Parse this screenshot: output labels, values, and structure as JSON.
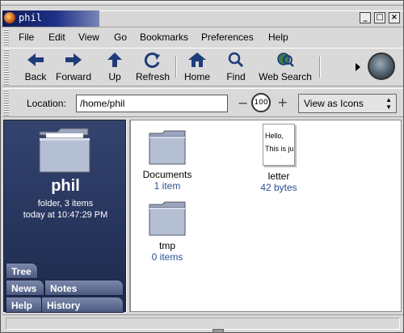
{
  "window": {
    "title": "phil"
  },
  "menu": [
    "File",
    "Edit",
    "View",
    "Go",
    "Bookmarks",
    "Preferences",
    "Help"
  ],
  "toolbar": {
    "back": "Back",
    "forward": "Forward",
    "up": "Up",
    "refresh": "Refresh",
    "home": "Home",
    "find": "Find",
    "web_search": "Web Search"
  },
  "location": {
    "label": "Location:",
    "value": "/home/phil",
    "zoom": "100",
    "view_mode": "View as Icons"
  },
  "sidebar": {
    "folder_name": "phil",
    "info_line1": "folder, 3 items",
    "info_line2": "today at 10:47:29 PM",
    "tabs": {
      "tree": "Tree",
      "news": "News",
      "notes": "Notes",
      "help": "Help",
      "history": "History"
    }
  },
  "files": [
    {
      "name": "Documents",
      "detail": "1 item",
      "icon": "folder-icon"
    },
    {
      "name": "letter",
      "detail": "42 bytes",
      "icon": "text-document-icon",
      "preview_line1": "Hello,",
      "preview_line2": "This is ju"
    },
    {
      "name": "tmp",
      "detail": "0 items",
      "icon": "folder-icon"
    }
  ],
  "colors": {
    "sidebar_bg": "#2c3a64",
    "title_gradient": "#0e1c59",
    "detail_text": "#2a4f93"
  }
}
